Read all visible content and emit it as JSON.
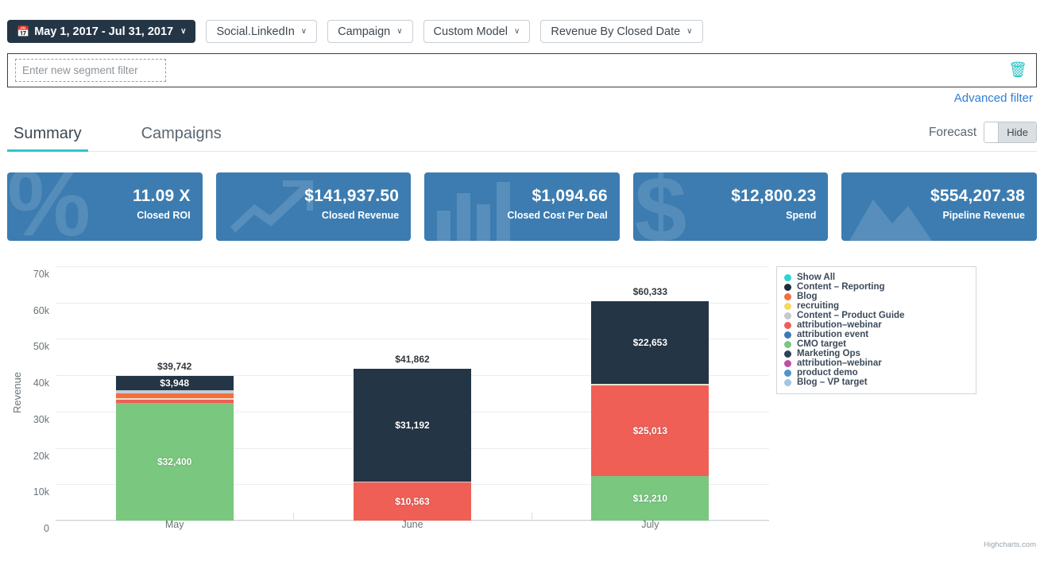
{
  "toolbar": {
    "date_range": "May 1, 2017 - Jul 31, 2017",
    "calendar_icon": "calendar-icon",
    "dropdowns": [
      {
        "label": "Social.LinkedIn"
      },
      {
        "label": "Campaign"
      },
      {
        "label": "Custom Model"
      },
      {
        "label": "Revenue By Closed Date"
      }
    ],
    "caret": "∨"
  },
  "segment_filter": {
    "placeholder": "Enter new segment filter",
    "value": "",
    "delete_icon": "trash-icon",
    "advanced_link": "Advanced filter"
  },
  "tabs": {
    "items": [
      {
        "label": "Summary",
        "active": true
      },
      {
        "label": "Campaigns",
        "active": false
      }
    ],
    "forecast_label": "Forecast",
    "forecast_toggle": "Hide"
  },
  "kpis": [
    {
      "value": "11.09 X",
      "label": "Closed ROI",
      "glyph": "percent-icon"
    },
    {
      "value": "$141,937.50",
      "label": "Closed Revenue",
      "glyph": "trend-arrow-icon"
    },
    {
      "value": "$1,094.66",
      "label": "Closed Cost Per Deal",
      "glyph": "bar-chart-icon"
    },
    {
      "value": "$12,800.23",
      "label": "Spend",
      "glyph": "dollar-icon"
    },
    {
      "value": "$554,207.38",
      "label": "Pipeline Revenue",
      "glyph": "mountain-icon"
    }
  ],
  "colors": {
    "accent_teal": "#2ec7ce",
    "kpi_blue": "#3c7cb0",
    "date_pill": "#243546",
    "link_blue": "#2f7fd4"
  },
  "chart_data": {
    "type": "bar",
    "title": "",
    "xlabel": "",
    "ylabel": "Revenue",
    "categories": [
      "May",
      "June",
      "July"
    ],
    "ylim": [
      0,
      70000
    ],
    "yticks": [
      "0",
      "10k",
      "20k",
      "30k",
      "40k",
      "50k",
      "60k",
      "70k"
    ],
    "ytick_values": [
      0,
      10000,
      20000,
      30000,
      40000,
      50000,
      60000,
      70000
    ],
    "grid": true,
    "stacked": true,
    "legend_position": "right",
    "totals": [
      "$39,742",
      "$41,862",
      "$60,333"
    ],
    "total_values": [
      39742,
      41862,
      60333
    ],
    "series": [
      {
        "name": "CMO target",
        "color": "#7ac77f",
        "values": [
          32400,
          0,
          12210
        ],
        "labels": [
          "$32,400",
          "",
          "$12,210"
        ]
      },
      {
        "name": "attribution-webinar",
        "color": "#ef5f56",
        "values": [
          900,
          10563,
          25013
        ],
        "labels": [
          "",
          "$10,563",
          "$25,013"
        ]
      },
      {
        "name": "Content - Product Guide",
        "color": "#e8e2cf",
        "values": [
          300,
          0,
          470
        ],
        "labels": [
          "",
          "",
          ""
        ]
      },
      {
        "name": "Blog",
        "color": "#f4703a",
        "values": [
          1400,
          0,
          0
        ],
        "labels": [
          "",
          "",
          ""
        ]
      },
      {
        "name": "recruiting",
        "color": "#c8ccd8",
        "values": [
          794,
          107,
          0
        ],
        "labels": [
          "",
          "",
          ""
        ]
      },
      {
        "name": "Content - Reporting",
        "color": "#243546",
        "values": [
          3948,
          31192,
          22653
        ],
        "labels": [
          "$3,948",
          "$31,192",
          "$22,653"
        ]
      }
    ],
    "legend": [
      {
        "label": "Show All",
        "color": "#2ed4d4"
      },
      {
        "label": "Content – Reporting",
        "color": "#1f2d3d"
      },
      {
        "label": "Blog",
        "color": "#f4703a"
      },
      {
        "label": "recruiting",
        "color": "#f7d661"
      },
      {
        "label": "Content – Product Guide",
        "color": "#c6c9cb"
      },
      {
        "label": "attribution–webinar",
        "color": "#ef5f56"
      },
      {
        "label": "attribution event",
        "color": "#3b7bb5"
      },
      {
        "label": "CMO target",
        "color": "#7ac77f"
      },
      {
        "label": "Marketing Ops",
        "color": "#2b4358"
      },
      {
        "label": "attribution–webinar",
        "color": "#bf4fa6"
      },
      {
        "label": "product demo",
        "color": "#4e95cc"
      },
      {
        "label": "Blog – VP target",
        "color": "#9fc6e3"
      }
    ],
    "credits": "Highcharts.com"
  }
}
